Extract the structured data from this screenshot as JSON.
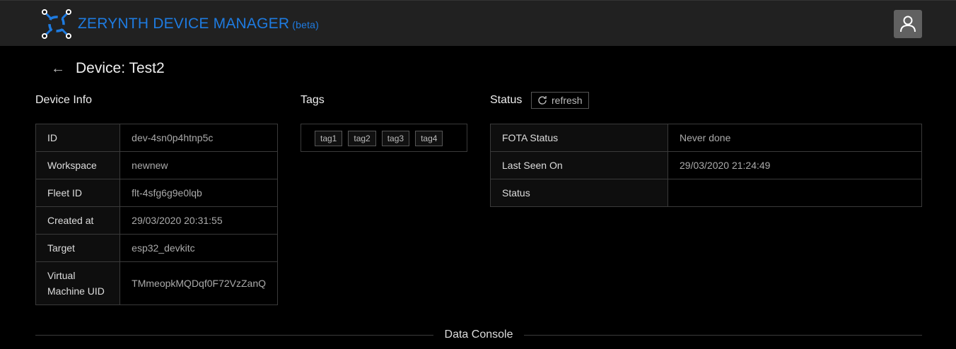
{
  "header": {
    "app_title": "ZERYNTH DEVICE MANAGER",
    "beta": "(beta)",
    "brand_color": "#1e7be0"
  },
  "page": {
    "title": "Device: Test2"
  },
  "device_info": {
    "heading": "Device Info",
    "rows": [
      {
        "label": "ID",
        "value": "dev-4sn0p4htnp5c"
      },
      {
        "label": "Workspace",
        "value": "newnew"
      },
      {
        "label": "Fleet ID",
        "value": "flt-4sfg6g9e0lqb"
      },
      {
        "label": "Created at",
        "value": "29/03/2020 20:31:55"
      },
      {
        "label": "Target",
        "value": "esp32_devkitc"
      },
      {
        "label": "Virtual Machine UID",
        "value": "TMmeopkMQDqf0F72VzZanQ"
      }
    ]
  },
  "tags": {
    "heading": "Tags",
    "items": [
      "tag1",
      "tag2",
      "tag3",
      "tag4"
    ]
  },
  "status": {
    "heading": "Status",
    "refresh_label": "refresh",
    "rows": [
      {
        "label": "FOTA Status",
        "value": "Never done"
      },
      {
        "label": "Last Seen On",
        "value": "29/03/2020 21:24:49"
      },
      {
        "label": "Status",
        "value": ""
      }
    ]
  },
  "console": {
    "label": "Data Console"
  }
}
